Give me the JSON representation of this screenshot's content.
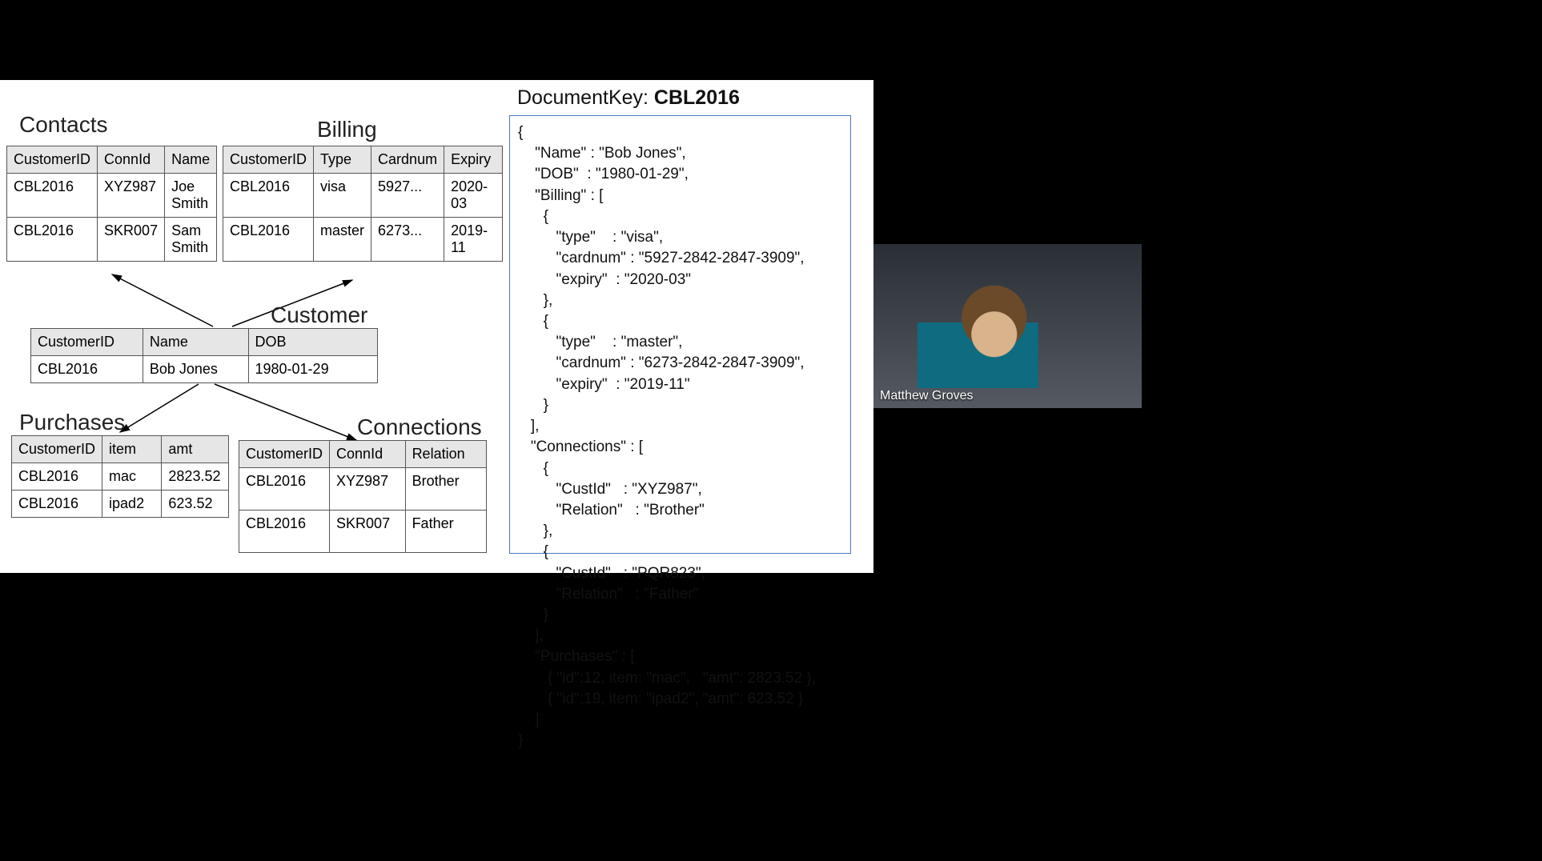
{
  "titles": {
    "contacts": "Contacts",
    "billing": "Billing",
    "customer": "Customer",
    "purchases": "Purchases",
    "connections": "Connections",
    "docKeyLabel": "DocumentKey:",
    "docKeyValue": "CBL2016"
  },
  "contacts": {
    "headers": [
      "CustomerID",
      "ConnId",
      "Name"
    ],
    "rows": [
      [
        "CBL2016",
        "XYZ987",
        "Joe Smith"
      ],
      [
        "CBL2016",
        "SKR007",
        "Sam Smith"
      ]
    ]
  },
  "billing": {
    "headers": [
      "CustomerID",
      "Type",
      "Cardnum",
      "Expiry"
    ],
    "rows": [
      [
        "CBL2016",
        "visa",
        "5927...",
        "2020-03"
      ],
      [
        "CBL2016",
        "master",
        "6273...",
        "2019-11"
      ]
    ]
  },
  "customer": {
    "headers": [
      "CustomerID",
      "Name",
      "DOB"
    ],
    "rows": [
      [
        "CBL2016",
        "Bob Jones",
        "1980-01-29"
      ]
    ]
  },
  "purchases": {
    "headers": [
      "CustomerID",
      "item",
      "amt"
    ],
    "rows": [
      [
        "CBL2016",
        "mac",
        "2823.52"
      ],
      [
        "CBL2016",
        "ipad2",
        "623.52"
      ]
    ]
  },
  "connections": {
    "headers": [
      "CustomerID",
      "ConnId",
      "Relation"
    ],
    "rows": [
      [
        "CBL2016",
        "XYZ987",
        "Brother"
      ],
      [
        "CBL2016",
        "SKR007",
        "Father"
      ]
    ]
  },
  "json_display": "{\n    \"Name\" : \"Bob Jones\",\n    \"DOB\"  : \"1980-01-29\",\n    \"Billing\" : [\n      {\n         \"type\"    : \"visa\",\n         \"cardnum\" : \"5927-2842-2847-3909\",\n         \"expiry\"  : \"2020-03\"\n      },\n      {\n         \"type\"    : \"master\",\n         \"cardnum\" : \"6273-2842-2847-3909\",\n         \"expiry\"  : \"2019-11\"\n      }\n   ],\n   \"Connections\" : [\n      {\n         \"CustId\"   : \"XYZ987\",\n         \"Relation\"   : \"Brother\"\n      },\n      {\n         \"CustId\"   : \"PQR823\",\n         \"Relation\"   : \"Father\"\n      }\n    ],\n    \"Purchases\" : [\n       { \"id\":12, item: \"mac\",   \"amt\": 2823.52 },\n       { \"id\":19, item: \"ipad2\", \"amt\": 623.52 }\n    ]\n}",
  "presenter": "Matthew Groves"
}
